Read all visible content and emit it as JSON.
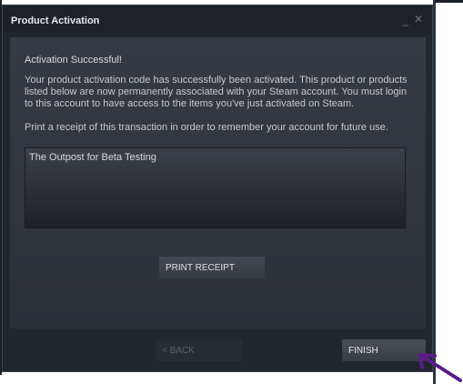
{
  "window": {
    "title": "Product Activation",
    "minimize_glyph": "_",
    "close_glyph": "✕"
  },
  "content": {
    "heading": "Activation Successful!",
    "message": "Your product activation code has successfully been activated. This product or products listed below are now permanently associated with your Steam account. You must login to this account to have access to the items you've just activated on Steam.",
    "receipt_hint": "Print a receipt of this transaction in order to remember your account for future use.",
    "products": [
      "The Outpost for Beta Testing"
    ]
  },
  "buttons": {
    "print_receipt": "PRINT RECEIPT",
    "back": "< BACK",
    "finish": "FINISH"
  },
  "colors": {
    "window_bg": "#22262d",
    "panel_bg": "#32363d",
    "text": "#c6c9cc",
    "annotation": "#5a1a8a"
  },
  "icons": {
    "minimize": "minimize-icon",
    "close": "close-icon",
    "pointer": "hand-drawn-arrow"
  }
}
